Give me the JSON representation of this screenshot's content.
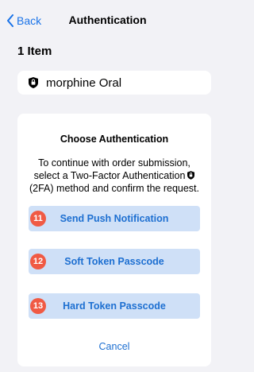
{
  "nav": {
    "back_label": "Back",
    "title": "Authentication"
  },
  "order": {
    "count_label": "1 Item",
    "item_name": "morphine Oral"
  },
  "auth": {
    "title": "Choose Authentication",
    "description_line1": "To continue with order submission,",
    "description_line2": "select a Two-Factor Authentication",
    "description_line3": "(2FA) method and confirm the request.",
    "methods": [
      {
        "number": "11",
        "label": "Send Push Notification"
      },
      {
        "number": "12",
        "label": "Soft Token Passcode"
      },
      {
        "number": "13",
        "label": "Hard Token Passcode"
      }
    ],
    "cancel_label": "Cancel"
  },
  "colors": {
    "accent": "#1d6fd1",
    "button_bg": "#cfe0f7",
    "badge": "#f05a44",
    "background": "#f2f2f6"
  }
}
